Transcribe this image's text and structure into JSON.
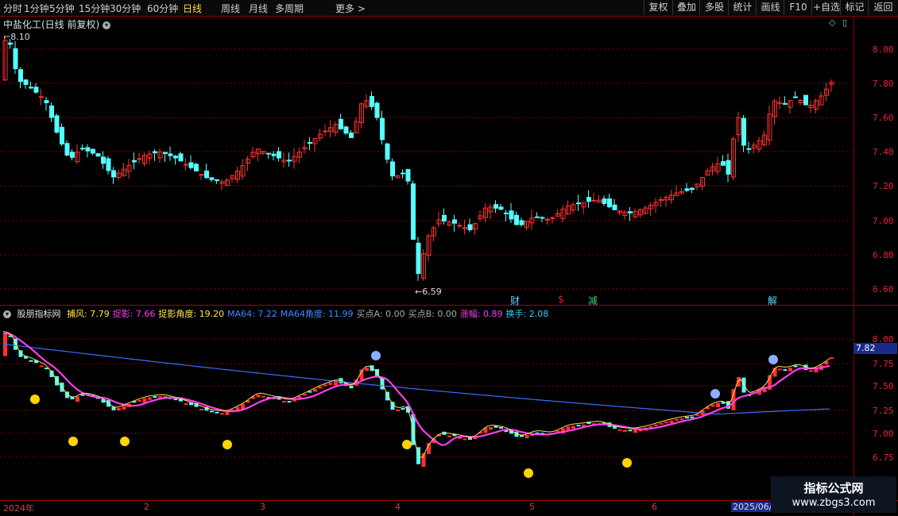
{
  "toolbar": {
    "periods": [
      "分时",
      "1分钟",
      "5分钟",
      "15分钟",
      "30分钟",
      "60分钟",
      "日线",
      "周线",
      "月线",
      "多周期",
      "更多 >"
    ],
    "active_period": "日线",
    "tools": [
      "复权",
      "叠加",
      "多股",
      "统计",
      "画线",
      "F10",
      "+自选",
      "标记",
      "返回"
    ]
  },
  "main": {
    "title": "中盐化工(日线 前复权)",
    "high_label": "8.10",
    "low_label": "6.59",
    "y_ticks": [
      "8.00",
      "7.80",
      "7.60",
      "7.40",
      "7.20",
      "7.00",
      "6.80",
      "6.60"
    ],
    "events": [
      {
        "label": "财",
        "color": "#59d4ff"
      },
      {
        "label": "$",
        "color": "#e0242b"
      },
      {
        "label": "减",
        "color": "#37d67a"
      },
      {
        "label": "解",
        "color": "#59d4ff"
      }
    ]
  },
  "indicator": {
    "name": "股朋指标网",
    "items": [
      {
        "label": "捕风: 7.79",
        "color": "#ffe14a"
      },
      {
        "label": "捉影: 7.66",
        "color": "#ff3cf0"
      },
      {
        "label": "捉影角度: 19.20",
        "color": "#ffe14a"
      },
      {
        "label": "MA64: 7.22",
        "color": "#3c8cff"
      },
      {
        "label": "MA64角度: 11.99",
        "color": "#3c8cff"
      },
      {
        "label": "买点A: 0.00",
        "color": "#aaaaaa"
      },
      {
        "label": "买点B: 0.00",
        "color": "#aaaaaa"
      },
      {
        "label": "涨幅: 0.89",
        "color": "#ff3cf0"
      },
      {
        "label": "换手: 2.08",
        "color": "#3cc8ff"
      }
    ],
    "y_ticks": [
      "8.00",
      "7.75",
      "7.50",
      "7.25",
      "7.00",
      "6.75"
    ],
    "current_price": "7.82"
  },
  "x_axis": [
    "2024年",
    "2",
    "3",
    "4",
    "5",
    "6",
    "2025/06/"
  ],
  "watermark": {
    "line1": "指标公式网",
    "line2": "www.zbgs3.com"
  },
  "colors": {
    "up": "#ff3030",
    "down": "#54ffff",
    "grid": "#8a0000",
    "ma64": "#3c6cff",
    "fast": "#ffe14a",
    "slow": "#ff3cf0"
  }
}
